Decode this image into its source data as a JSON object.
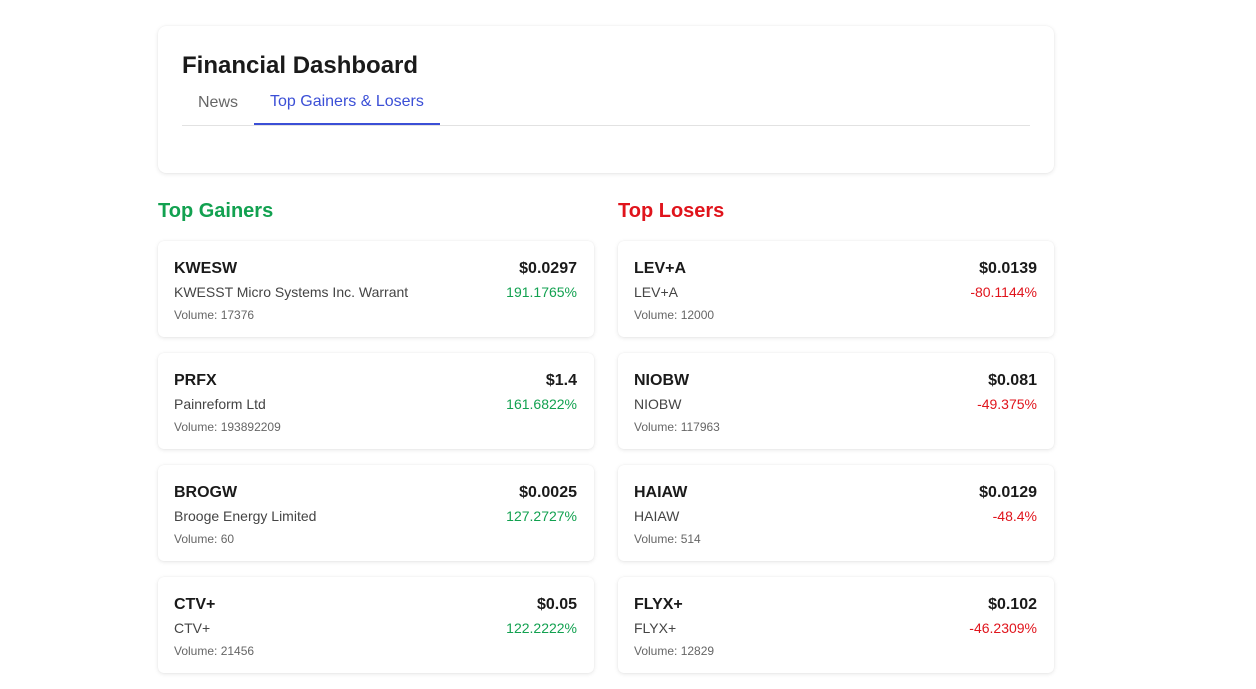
{
  "header": {
    "title": "Financial Dashboard",
    "tabs": [
      {
        "label": "News",
        "active": false
      },
      {
        "label": "Top Gainers & Losers",
        "active": true
      }
    ]
  },
  "colors": {
    "accent": "#3b4fd6",
    "gain": "#12a150",
    "loss": "#e0141c"
  },
  "gainers": {
    "title": "Top Gainers",
    "items": [
      {
        "ticker": "KWESW",
        "price": "$0.0297",
        "company": "KWESST Micro Systems Inc. Warrant",
        "change": "191.1765%",
        "volume": "Volume: 17376"
      },
      {
        "ticker": "PRFX",
        "price": "$1.4",
        "company": "Painreform Ltd",
        "change": "161.6822%",
        "volume": "Volume: 193892209"
      },
      {
        "ticker": "BROGW",
        "price": "$0.0025",
        "company": "Brooge Energy Limited",
        "change": "127.2727%",
        "volume": "Volume: 60"
      },
      {
        "ticker": "CTV+",
        "price": "$0.05",
        "company": "CTV+",
        "change": "122.2222%",
        "volume": "Volume: 21456"
      }
    ]
  },
  "losers": {
    "title": "Top Losers",
    "items": [
      {
        "ticker": "LEV+A",
        "price": "$0.0139",
        "company": "LEV+A",
        "change": "-80.1144%",
        "volume": "Volume: 12000"
      },
      {
        "ticker": "NIOBW",
        "price": "$0.081",
        "company": "NIOBW",
        "change": "-49.375%",
        "volume": "Volume: 117963"
      },
      {
        "ticker": "HAIAW",
        "price": "$0.0129",
        "company": "HAIAW",
        "change": "-48.4%",
        "volume": "Volume: 514"
      },
      {
        "ticker": "FLYX+",
        "price": "$0.102",
        "company": "FLYX+",
        "change": "-46.2309%",
        "volume": "Volume: 12829"
      }
    ]
  }
}
